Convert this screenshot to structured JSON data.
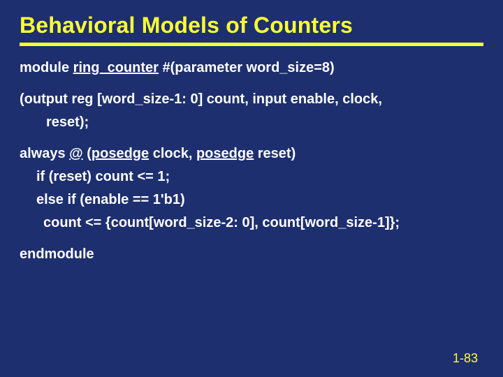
{
  "title": "Behavioral Models of Counters",
  "line1_pre": "module ",
  "line1_mid": "ring_counter",
  "line1_post": " #(parameter word_size=8)",
  "line2a": "(output reg [word_size-1: 0] count, input enable, clock,",
  "line2b": "reset);",
  "line3_pre": "always ",
  "line3_at": "@",
  "line3_mid": " (",
  "line3_p1": "posedge",
  "line3_sep": " clock, ",
  "line3_p2": "posedge",
  "line3_end": " reset)",
  "line4": "if (reset) count <= 1;",
  "line5": "else if (enable == 1'b1)",
  "line6": "count <= {count[word_size-2: 0], count[word_size-1]};",
  "line7": "endmodule",
  "pagenum": "1-83"
}
